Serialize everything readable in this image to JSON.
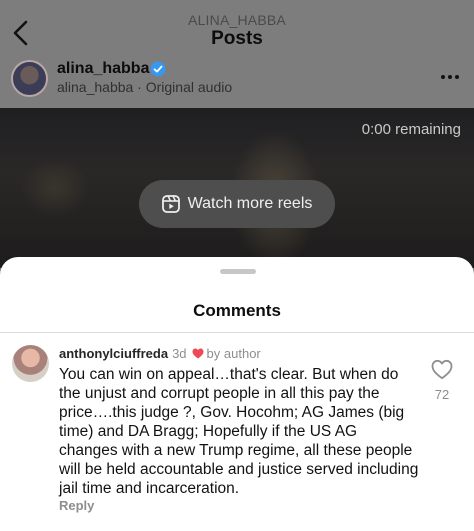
{
  "header": {
    "username": "ALINA_HABBA",
    "title": "Posts"
  },
  "post": {
    "author": "alina_habba",
    "subtitle": "alina_habba · Original audio"
  },
  "video": {
    "remaining": "0:00 remaining",
    "watch_more_label": "Watch more reels"
  },
  "comments": {
    "title": "Comments",
    "items": [
      {
        "user": "anthonylciuffreda",
        "time": "3d",
        "liked_by": "by author",
        "text": "You can win on appeal…that's clear. But when do the unjust and corrupt people in all this pay the price….this judge ?, Gov. Hocohm;  AG James (big time) and DA Bragg;  Hopefully if the US AG changes with a new Trump  regime, all these people will be held accountable and justice served including jail time and incarceration.",
        "reply_label": "Reply",
        "likes": "72"
      }
    ]
  },
  "colors": {
    "verified": "#3897f0",
    "author_heart": "#ed4956"
  },
  "icons": {
    "back": "chevron-left-icon",
    "verified": "verified-badge-icon",
    "more": "more-horizontal-icon",
    "reels": "reels-icon",
    "like": "heart-outline-icon"
  }
}
